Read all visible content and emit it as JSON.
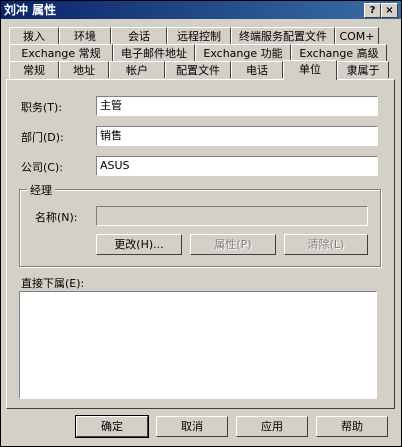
{
  "window": {
    "title": "刘冲 属性",
    "help_button": "?",
    "close_button": "×"
  },
  "tabs": {
    "row1": [
      "拨入",
      "环境",
      "会话",
      "远程控制",
      "终端服务配置文件",
      "COM+"
    ],
    "row2": [
      "Exchange 常规",
      "电子邮件地址",
      "Exchange 功能",
      "Exchange 高级"
    ],
    "row3": [
      "常规",
      "地址",
      "帐户",
      "配置文件",
      "电话",
      "单位",
      "隶属于"
    ],
    "active": "单位"
  },
  "form": {
    "title_label": "职务(T):",
    "title_value": "主管",
    "department_label": "部门(D):",
    "department_value": "销售",
    "company_label": "公司(C):",
    "company_value": "ASUS"
  },
  "manager": {
    "group_title": "经理",
    "name_label": "名称(N):",
    "name_value": "",
    "change_button": "更改(H)...",
    "properties_button": "属性(P)",
    "clear_button": "清除(L)"
  },
  "direct_reports": {
    "label": "直接下属(E):"
  },
  "footer": {
    "ok_button": "确定",
    "cancel_button": "取消",
    "apply_button": "应用",
    "help_button": "帮助"
  }
}
